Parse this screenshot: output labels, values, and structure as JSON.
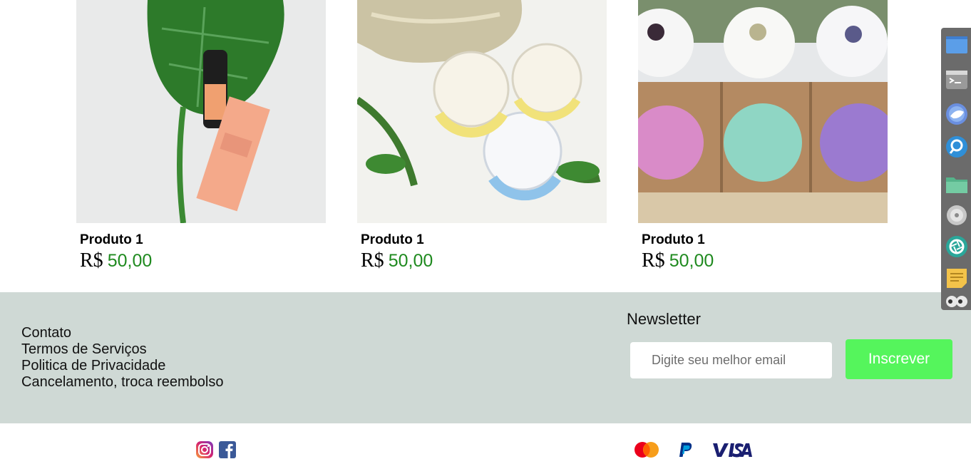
{
  "products": [
    {
      "name": "Produto 1",
      "currency": "R$",
      "price": "50,00",
      "image": "serum-bottle-and-box-on-leaf"
    },
    {
      "name": "Produto 1",
      "currency": "R$",
      "price": "50,00",
      "image": "hemp-balm-tins-in-gold-pouch"
    },
    {
      "name": "Produto 1",
      "currency": "R$",
      "price": "50,00",
      "image": "bath-bombs-on-boxes"
    }
  ],
  "footer": {
    "links": [
      "Contato",
      "Termos de Serviços",
      "Politica de Privacidade",
      "Cancelamento, troca reembolso"
    ],
    "newsletter": {
      "title": "Newsletter",
      "placeholder": "Digite seu melhor email",
      "button": "Inscrever"
    }
  },
  "social_icons": [
    "instagram-icon",
    "facebook-icon"
  ],
  "payment_methods": [
    "MasterCard",
    "PayPal",
    "VISA"
  ],
  "dock_icons": [
    "desktop-icon",
    "terminal-icon",
    "browser-icon",
    "search-icon",
    "files-icon",
    "disk-icon",
    "aperture-icon",
    "notes-icon",
    "eyes-icon"
  ],
  "colors": {
    "price": "#1f8a1f",
    "footer_bg": "#cfd9d5",
    "subscribe_bg": "#55f55c"
  }
}
